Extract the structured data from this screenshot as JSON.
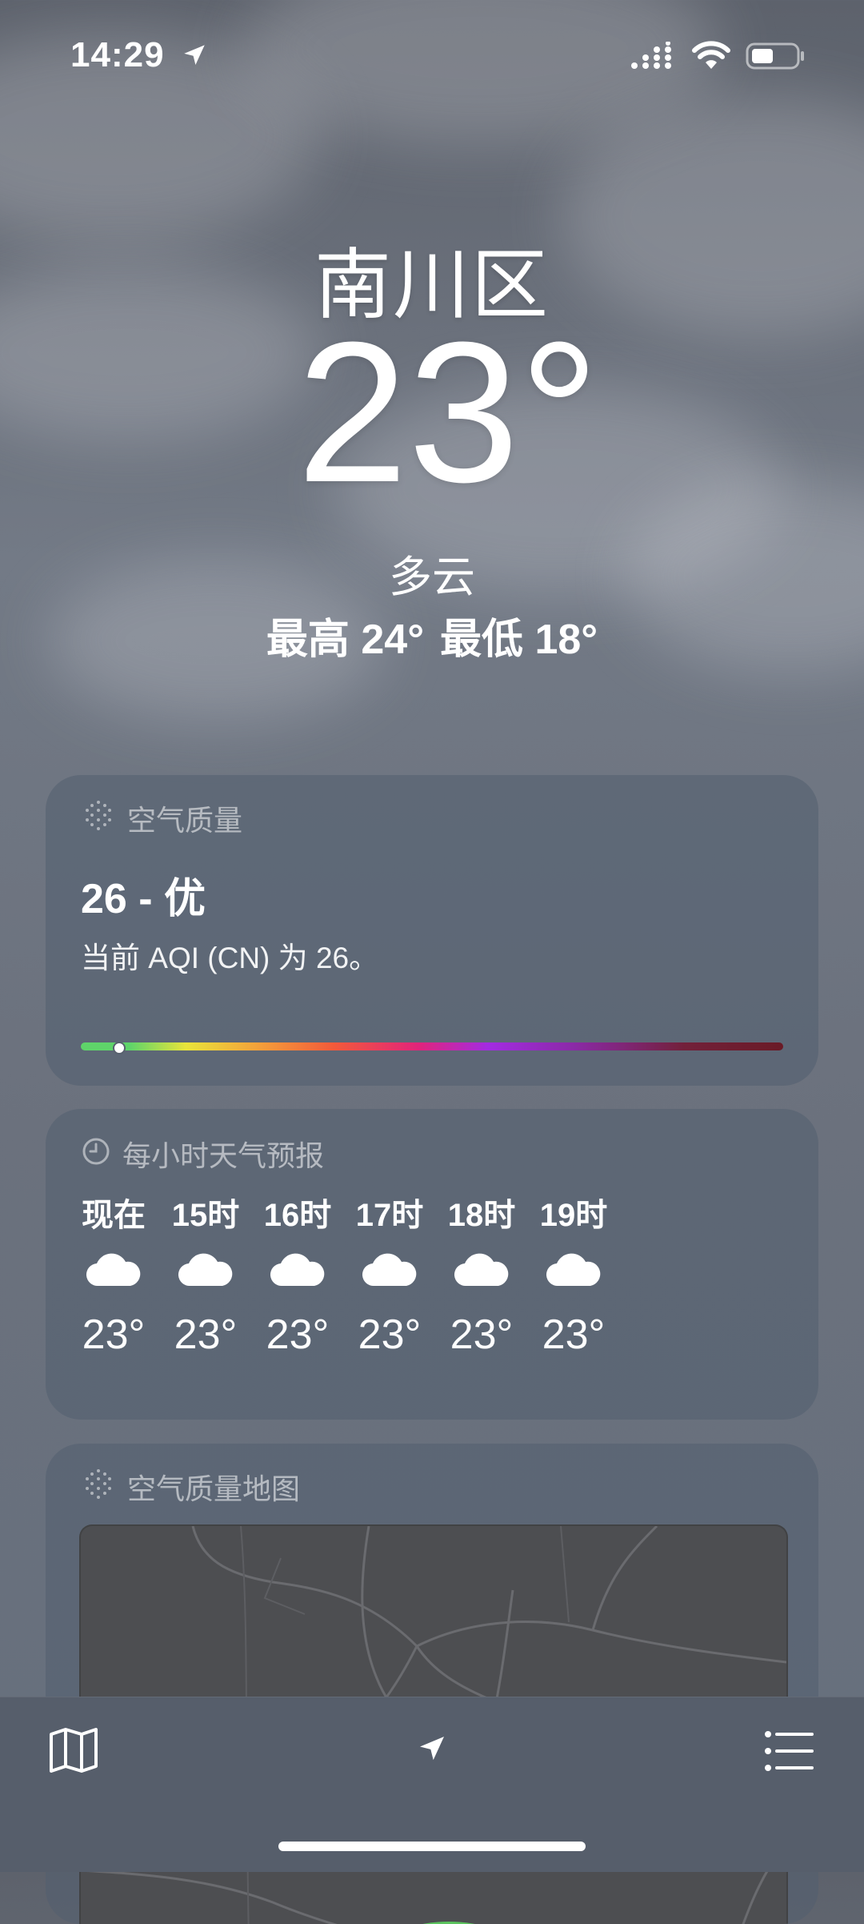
{
  "status_bar": {
    "time": "14:29",
    "icons": [
      "location-arrow-icon",
      "cellular-signal-icon",
      "wifi-icon",
      "battery-icon"
    ]
  },
  "header": {
    "city": "南川区",
    "temperature": "23°",
    "condition": "多云",
    "high": "最高 24°",
    "low": "最低 18°"
  },
  "air_quality": {
    "title": "空气质量",
    "value": "26 - 优",
    "description": "当前 AQI (CN) 为 26。",
    "level_fraction": 0.055
  },
  "hourly": {
    "title": "每小时天气预报",
    "items": [
      {
        "label": "现在",
        "icon": "cloud-icon",
        "temp": "23°"
      },
      {
        "label": "15时",
        "icon": "cloud-icon",
        "temp": "23°"
      },
      {
        "label": "16时",
        "icon": "cloud-icon",
        "temp": "23°"
      },
      {
        "label": "17时",
        "icon": "cloud-icon",
        "temp": "23°"
      },
      {
        "label": "18时",
        "icon": "cloud-icon",
        "temp": "23°"
      },
      {
        "label": "19时",
        "icon": "cloud-icon",
        "temp": "23°"
      }
    ]
  },
  "aqi_map": {
    "title": "空气质量地图"
  },
  "tab_bar": {
    "icons": [
      "map-icon",
      "location-arrow-icon",
      "list-icon"
    ]
  },
  "colors": {
    "aqi_good": "#5fd46a",
    "card_background": "#525e70",
    "tab_bar": "#565e6b"
  }
}
